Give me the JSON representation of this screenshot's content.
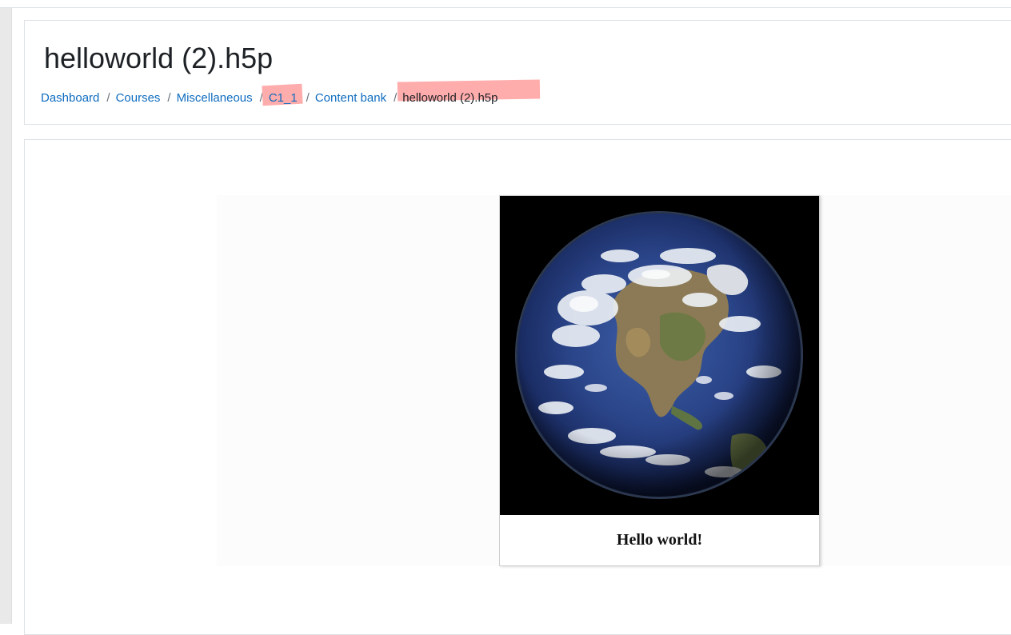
{
  "page": {
    "title": "helloworld (2).h5p"
  },
  "breadcrumb": {
    "items": [
      {
        "label": "Dashboard"
      },
      {
        "label": "Courses"
      },
      {
        "label": "Miscellaneous"
      },
      {
        "label": "C1_1"
      },
      {
        "label": "Content bank"
      }
    ],
    "current": "helloworld (2).h5p",
    "separator": "/"
  },
  "h5p": {
    "caption": "Hello world!",
    "image_icon": "earth-photo"
  },
  "colors": {
    "link": "#0f6cbf",
    "highlight": "#ff9d9d"
  }
}
